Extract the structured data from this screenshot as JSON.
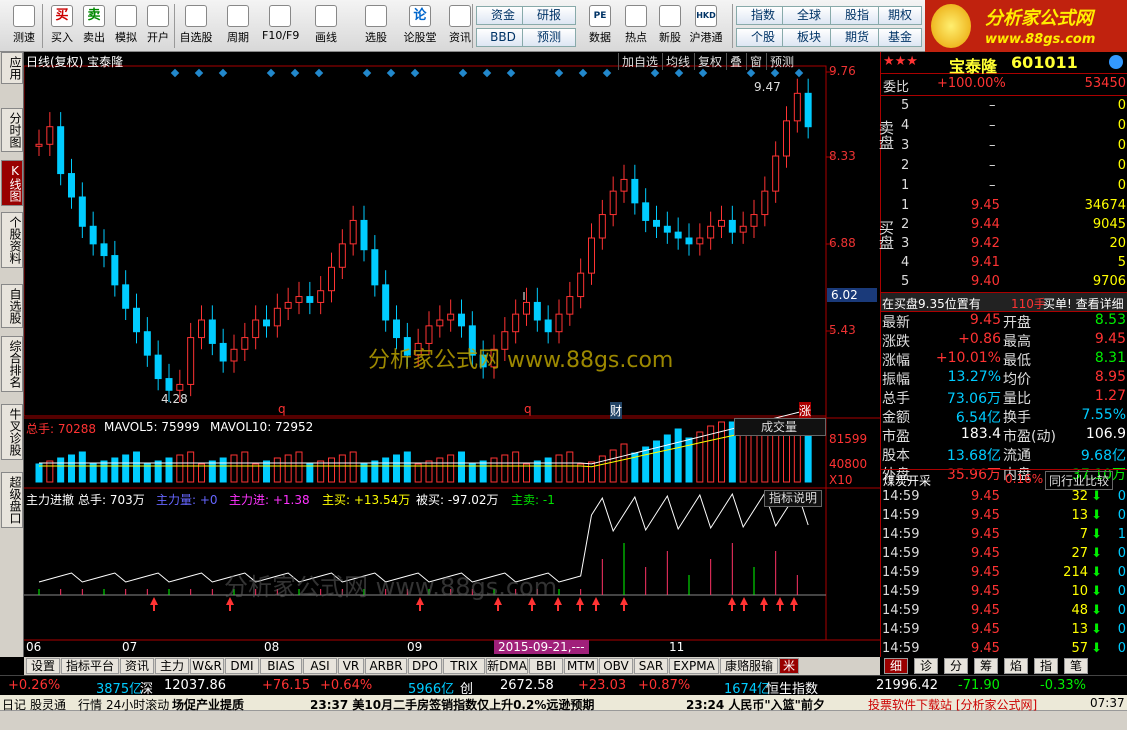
{
  "toolbar": {
    "buttons": [
      {
        "label": "测速",
        "icon": "clock-icon"
      },
      {
        "label": "买入",
        "icon": "buy-icon"
      },
      {
        "label": "卖出",
        "icon": "sell-icon"
      },
      {
        "label": "模拟",
        "icon": "hammer-icon"
      },
      {
        "label": "开户",
        "icon": "lock-icon"
      },
      {
        "label": "自选股",
        "icon": "star-icon"
      },
      {
        "label": "周期",
        "icon": "clock-icon"
      },
      {
        "label": "F10/F9",
        "icon": "f10-icon"
      },
      {
        "label": "画线",
        "icon": "pen-icon"
      },
      {
        "label": "选股",
        "icon": "picker-icon"
      },
      {
        "label": "论股堂",
        "icon": "discuss-icon"
      },
      {
        "label": "资讯",
        "icon": "news-icon"
      },
      {
        "label": "数据",
        "icon": "data-icon"
      },
      {
        "label": "热点",
        "icon": "fire-icon"
      },
      {
        "label": "新股",
        "icon": "newstock-icon"
      },
      {
        "label": "沪港通",
        "icon": "hkex-icon"
      }
    ],
    "top_icon_labels": {
      "buy": "买",
      "sell": "卖",
      "pe": "PE",
      "discuss": "论",
      "hkd": "HKD"
    },
    "small_buttons": [
      "资金",
      "研报",
      "BBD",
      "预测",
      "指数",
      "全球",
      "股指",
      "期权",
      "个股",
      "板块",
      "期货",
      "基金"
    ]
  },
  "logo": {
    "title": "分析家公式网",
    "url": "www.88gs.com"
  },
  "side_tabs": [
    "应用",
    "分时图",
    "K线图",
    "个股资料",
    "自选股",
    "综合排名",
    "牛叉诊股",
    "超级盘口"
  ],
  "chart": {
    "header": "日线(复权) 宝泰隆",
    "controls": [
      "加自选",
      "均线",
      "复权",
      "叠",
      "窗",
      "预测"
    ],
    "price_ticks": [
      "9.76",
      "8.33",
      "6.88",
      "6.02",
      "5.43"
    ],
    "current_price_tag": "6.02",
    "high_label": "9.47",
    "low_label": "4.28",
    "event_labels": [
      "q",
      "q",
      "财",
      "涨"
    ],
    "watermark": "分析家公式网  www.88gs.com",
    "watermark2": "分析家公式网  www.88gs.com",
    "volume": {
      "total": "总手: 70288",
      "ma5": "MAVOL5: 75999",
      "ma10": "MAVOL10: 72952",
      "dropdown": "成交量",
      "ticks": [
        "81599",
        "40800",
        "X10"
      ]
    },
    "indicator": {
      "name": "主力进撤",
      "total": "总手: 703万",
      "zhulixian": "主力量: +0",
      "zhulijin": "主力进: +1.38",
      "zhumai": "主买: +13.54万",
      "beimai": "被买: -97.02万",
      "zhumaichu": "主卖: -1",
      "help": "指标说明"
    },
    "month_labels": [
      "06",
      "07",
      "08",
      "09",
      "2015-09-21,---",
      "11"
    ]
  },
  "chart_data": {
    "type": "candlestick",
    "title": "日线(复权) 宝泰隆",
    "y_ticks": [
      9.76,
      8.33,
      6.88,
      6.02,
      5.43
    ],
    "annotations": {
      "high": 9.47,
      "low": 4.28
    },
    "x_labels": [
      "06",
      "07",
      "08",
      "09",
      "2015-09-21,---",
      "11"
    ],
    "close_series": [
      8.6,
      8.9,
      8.1,
      7.7,
      7.2,
      6.9,
      6.7,
      6.2,
      5.8,
      5.4,
      5.0,
      4.6,
      4.4,
      4.5,
      5.3,
      5.6,
      5.2,
      4.9,
      5.1,
      5.3,
      5.6,
      5.5,
      5.8,
      5.9,
      6.0,
      5.9,
      6.1,
      6.5,
      6.9,
      7.3,
      6.8,
      6.2,
      5.6,
      5.3,
      5.0,
      5.2,
      5.5,
      5.6,
      5.7,
      5.5,
      5.0,
      4.8,
      5.1,
      5.4,
      5.7,
      5.9,
      5.6,
      5.4,
      5.7,
      6.0,
      6.4,
      7.0,
      7.4,
      7.8,
      8.0,
      7.6,
      7.3,
      7.2,
      7.1,
      7.0,
      6.9,
      7.0,
      7.2,
      7.3,
      7.1,
      7.2,
      7.4,
      7.8,
      8.4,
      9.0,
      9.47,
      8.9
    ]
  },
  "quote": {
    "name": "宝泰隆",
    "code": "601011",
    "weibi_label": "委比",
    "weibi": "+100.00%",
    "weicha": "53450",
    "sell_label": "卖盘",
    "buy_label": "买盘",
    "asks": [
      {
        "lv": "5",
        "p": "–",
        "v": "0"
      },
      {
        "lv": "4",
        "p": "–",
        "v": "0"
      },
      {
        "lv": "3",
        "p": "–",
        "v": "0"
      },
      {
        "lv": "2",
        "p": "–",
        "v": "0"
      },
      {
        "lv": "1",
        "p": "–",
        "v": "0"
      }
    ],
    "bids": [
      {
        "lv": "1",
        "p": "9.45",
        "v": "34674"
      },
      {
        "lv": "2",
        "p": "9.44",
        "v": "9045"
      },
      {
        "lv": "3",
        "p": "9.42",
        "v": "20"
      },
      {
        "lv": "4",
        "p": "9.41",
        "v": "5"
      },
      {
        "lv": "5",
        "p": "9.40",
        "v": "9706"
      }
    ],
    "notice": "在买盘9.35位置有",
    "notice_vol": "110手",
    "notice_link": "买单! 查看详细",
    "stats": [
      {
        "l1": "最新",
        "v1": "9.45",
        "c1": "red",
        "l2": "开盘",
        "v2": "8.53",
        "c2": "grn"
      },
      {
        "l1": "涨跌",
        "v1": "+0.86",
        "c1": "red",
        "l2": "最高",
        "v2": "9.45",
        "c2": "red"
      },
      {
        "l1": "涨幅",
        "v1": "+10.01%",
        "c1": "red",
        "l2": "最低",
        "v2": "8.31",
        "c2": "grn"
      },
      {
        "l1": "振幅",
        "v1": "13.27%",
        "c1": "cyn",
        "l2": "均价",
        "v2": "8.95",
        "c2": "red"
      },
      {
        "l1": "总手",
        "v1": "73.06万",
        "c1": "cyn",
        "l2": "量比",
        "v2": "1.27",
        "c2": "red"
      },
      {
        "l1": "金额",
        "v1": "6.54亿",
        "c1": "cyn",
        "l2": "换手",
        "v2": "7.55%",
        "c2": "cyn"
      },
      {
        "l1": "市盈",
        "v1": "183.4",
        "c1": "wht",
        "l2": "市盈(动)",
        "v2": "106.9",
        "c2": "wht"
      },
      {
        "l1": "股本",
        "v1": "13.68亿",
        "c1": "cyn",
        "l2": "流通",
        "v2": "9.68亿",
        "c2": "cyn"
      },
      {
        "l1": "外盘",
        "v1": "35.96万",
        "c1": "red",
        "l2": "内盘",
        "v2": "37.10万",
        "c2": "grn"
      }
    ],
    "sector": "煤炭开采",
    "sector_pct": "0.16%",
    "sector_btn": "同行业比较",
    "ticks": [
      {
        "t": "14:59",
        "p": "9.45",
        "v": "32",
        "x": "0"
      },
      {
        "t": "14:59",
        "p": "9.45",
        "v": "13",
        "x": "0"
      },
      {
        "t": "14:59",
        "p": "9.45",
        "v": "7",
        "x": "1"
      },
      {
        "t": "14:59",
        "p": "9.45",
        "v": "27",
        "x": "0"
      },
      {
        "t": "14:59",
        "p": "9.45",
        "v": "214",
        "x": "0"
      },
      {
        "t": "14:59",
        "p": "9.45",
        "v": "10",
        "x": "0"
      },
      {
        "t": "14:59",
        "p": "9.45",
        "v": "48",
        "x": "0"
      },
      {
        "t": "14:59",
        "p": "9.45",
        "v": "13",
        "x": "0"
      },
      {
        "t": "14:59",
        "p": "9.45",
        "v": "57",
        "x": "0"
      }
    ]
  },
  "bottom_tabs": [
    "设置",
    "指标平台",
    "资讯",
    "主力",
    "W&R",
    "DMI",
    "BIAS",
    "ASI",
    "VR",
    "ARBR",
    "DPO",
    "TRIX",
    "新DMA",
    "BBI",
    "MTM",
    "OBV",
    "SAR",
    "EXPMA",
    "康赂服输"
  ],
  "bottom_tab_flag": "米",
  "right_tabs": [
    "细",
    "诊",
    "分",
    "筹",
    "焰",
    "指",
    "笔"
  ],
  "ticker": [
    {
      "t": "+0.26%",
      "c": "red"
    },
    {
      "t": "3875亿",
      "c": "cyn"
    },
    {
      "t": "深",
      "c": "wht"
    },
    {
      "t": "12037.86",
      "c": "wht"
    },
    {
      "t": "+76.15",
      "c": "red"
    },
    {
      "t": "+0.64%",
      "c": "red"
    },
    {
      "t": "5966亿",
      "c": "cyn"
    },
    {
      "t": "创",
      "c": "wht"
    },
    {
      "t": "2672.58",
      "c": "wht"
    },
    {
      "t": "+23.03",
      "c": "red"
    },
    {
      "t": "+0.87%",
      "c": "red"
    },
    {
      "t": "1674亿",
      "c": "cyn"
    },
    {
      "t": "恒生指数",
      "c": "wht"
    },
    {
      "t": "21996.42",
      "c": "wht"
    },
    {
      "t": "-71.90",
      "c": "grn"
    },
    {
      "t": "-0.33%",
      "c": "grn"
    }
  ],
  "status": {
    "items": [
      "日记",
      "股灵通",
      "行情",
      "24小时滚动"
    ],
    "news1": "场促产业提质",
    "news2": "23:37 美10月二手房签销指数仅上升0.2%远逊预期",
    "news3": "23:24 人民币\"入篮\"前夕",
    "news4": "投票软件下载站 [分析家公式网]",
    "time": "07:37"
  }
}
